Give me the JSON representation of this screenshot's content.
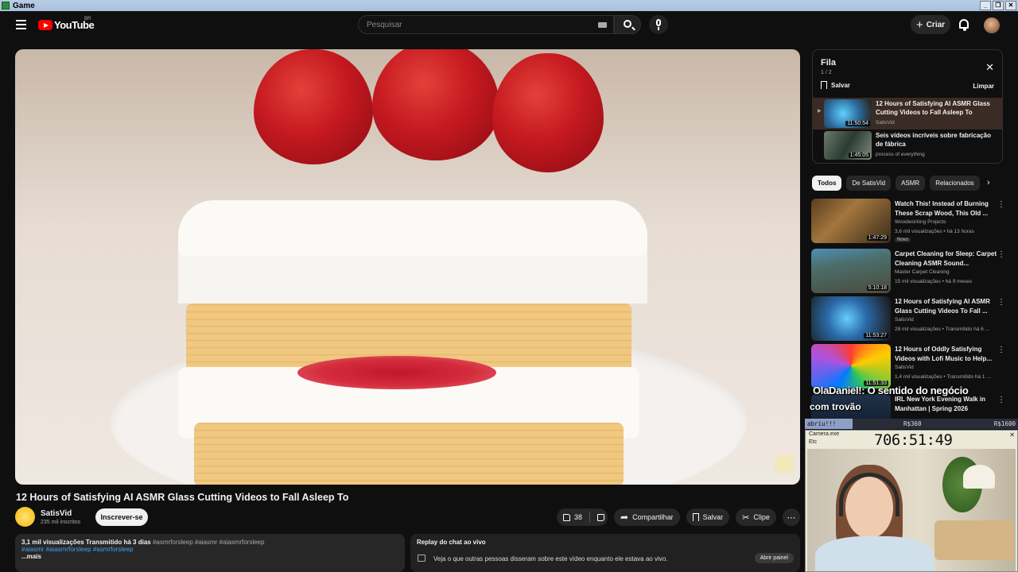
{
  "os_window": {
    "title": "Game"
  },
  "header": {
    "logo_text": "YouTube",
    "country_code": "BR",
    "search_placeholder": "Pesquisar",
    "create_label": "Criar"
  },
  "video": {
    "title": "12 Hours of Satisfying AI ASMR Glass Cutting Videos to Fall Asleep To",
    "channel": "SatisVid",
    "subscribers": "235 mil inscritos",
    "subscribe_label": "Inscrever-se",
    "likes": "38",
    "share_label": "Compartilhar",
    "save_label": "Salvar",
    "clip_label": "Clipe",
    "more_label": "⋯"
  },
  "description": {
    "views_date": "3,1 mil visualizações  Transmitido há 3 dias",
    "tags_line1": " #asmrforsleep #aiasmr #aiasmrforsleep",
    "tags_line2": "#aiasmr #aiasmrforsleep #asmrforsleep",
    "more": "...mais"
  },
  "chat_replay": {
    "title": "Replay do chat ao vivo",
    "text": "Veja o que outras pessoas disseram sobre este vídeo enquanto ele estava ao vivo.",
    "open_label": "Abrir painel"
  },
  "queue": {
    "title": "Fila",
    "count": "1 / 2",
    "save_label": "Salvar",
    "clear_label": "Limpar",
    "items": [
      {
        "title": "12 Hours of Satisfying AI ASMR Glass Cutting Videos to Fall Asleep To",
        "channel": "SatisVid",
        "duration": "11:50:54"
      },
      {
        "title": "Seis vídeos incríveis sobre fabricação de fábrica",
        "channel": "process of everything",
        "duration": "1:45:05"
      }
    ]
  },
  "chips": [
    "Todos",
    "De SatisVid",
    "ASMR",
    "Relacionados"
  ],
  "recommendations": [
    {
      "title": "Watch This! Instead of Burning These Scrap Wood, This Old ...",
      "channel": "Woodworking Projects",
      "meta": "3,6 mil visualizações • há 13 horas",
      "badge": "Novo",
      "duration": "1:47:29"
    },
    {
      "title": "Carpet Cleaning for Sleep: Carpet Cleaning ASMR Sound...",
      "channel": "Master Carpet Cleaning",
      "meta": "15 mil visualizações • há 9 meses",
      "badge": "",
      "duration": "5:10:18"
    },
    {
      "title": "12 Hours of Satisfying AI ASMR Glass Cutting Videos To Fall ...",
      "channel": "SatisVid",
      "meta": "28 mil visualizações • Transmitido há 6 ...",
      "badge": "",
      "duration": "11:53:27"
    },
    {
      "title": "12 Hours of Oddly Satisfying Videos with Lofi Music to Help...",
      "channel": "SatisVid",
      "meta": "1,4 mil visualizações • Transmitido há 1 ...",
      "badge": "",
      "duration": "11:51:33"
    },
    {
      "title": "IRL New York Evening Walk in Manhattan | Spring 2026",
      "channel": "",
      "meta": "",
      "badge": "",
      "duration": ""
    }
  ],
  "stream_overlay": {
    "line1": "OlaDaniel!: O sentido do negócio",
    "line2": "com trovão"
  },
  "donation_bar": {
    "label": "abriu!!!",
    "value1": "R$360",
    "value2": "R$1600",
    "progress": 0.225
  },
  "camera_window": {
    "title": "Camera.exe",
    "menu": "Etc",
    "timer": "706:51:49"
  },
  "colors": {
    "background": "#0f0f0f",
    "accent_red": "#ff0000",
    "link_blue": "#3ea6ff"
  }
}
